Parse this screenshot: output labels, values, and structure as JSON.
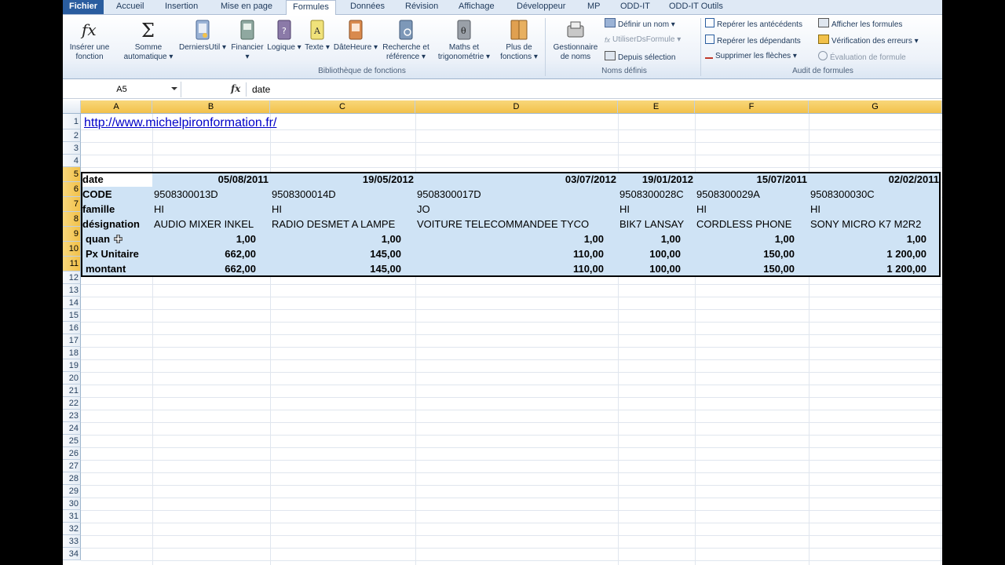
{
  "tabs": {
    "file": "Fichier",
    "items": [
      "Accueil",
      "Insertion",
      "Mise en page",
      "Formules",
      "Données",
      "Révision",
      "Affichage",
      "Développeur",
      "MP",
      "ODD-IT",
      "ODD-IT Outils"
    ]
  },
  "ribbon": {
    "insert_fn": [
      "Insérer une",
      "fonction"
    ],
    "autosum": [
      "Somme",
      "automatique ▾"
    ],
    "lib_buttons": [
      {
        "label": "DerniersUtil ▾",
        "icon": "recently-used-icon"
      },
      {
        "label": "Financier ▾",
        "icon": "financial-icon"
      },
      {
        "label": "Logique ▾",
        "icon": "logical-icon"
      },
      {
        "label": "Texte ▾",
        "icon": "text-icon"
      },
      {
        "label": "DâteHeure ▾",
        "icon": "date-time-icon"
      },
      {
        "label": "Recherche et",
        "label2": "référence ▾",
        "icon": "lookup-icon"
      },
      {
        "label": "Maths et",
        "label2": "trigonométrie ▾",
        "icon": "math-icon"
      },
      {
        "label": "Plus de",
        "label2": "fonctions ▾",
        "icon": "more-functions-icon"
      }
    ],
    "lib_group": "Bibliothèque de fonctions",
    "name_manager": [
      "Gestionnaire",
      "de noms"
    ],
    "names": {
      "define": "Définir un nom ▾",
      "use": "UtiliserDsFormule ▾",
      "from_sel": "Depuis sélection",
      "group": "Noms définis"
    },
    "audit": {
      "precedents": "Repérer les antécédents",
      "dependents": "Repérer les dépendants",
      "remove_arrows": "Supprimer les flèches ▾",
      "show_formulas": "Afficher les formules",
      "error_check": "Vérification des erreurs ▾",
      "evaluate": "Évaluation de formule",
      "group": "Audit de formules"
    }
  },
  "formula_bar": {
    "name_box": "A5",
    "fx": "fx",
    "content": "date"
  },
  "columns": [
    "A",
    "B",
    "C",
    "D",
    "E",
    "F",
    "G"
  ],
  "rows": [
    "1",
    "2",
    "3",
    "4",
    "5",
    "6",
    "7",
    "8",
    "9",
    "10",
    "11",
    "12",
    "13",
    "14",
    "15",
    "16",
    "17",
    "18",
    "19",
    "20",
    "21",
    "22",
    "23",
    "24",
    "25",
    "26",
    "27",
    "28",
    "29",
    "30",
    "31",
    "32",
    "33",
    "34"
  ],
  "link": "http://www.michelpironformation.fr/",
  "table": {
    "labels": [
      "date",
      "CODE",
      "famille",
      "désignation",
      "quan",
      "Px Unitaire",
      "montant"
    ],
    "dates": [
      "05/08/2011",
      "19/05/2012",
      "03/07/2012",
      "19/01/2012",
      "15/07/2011",
      "02/02/2011"
    ],
    "codes": [
      "9508300013D",
      "9508300014D",
      "9508300017D",
      "9508300028C",
      "9508300029A",
      "9508300030C"
    ],
    "familles": [
      "HI",
      "HI",
      "JO",
      "HI",
      "HI",
      "HI"
    ],
    "designations": [
      "AUDIO MIXER INKEL",
      "RADIO DESMET A LAMPE",
      "VOITURE TELECOMMANDEE TYCO",
      "BIK7 LANSAY",
      "CORDLESS PHONE",
      "SONY MICRO K7 M2R2"
    ],
    "quantites": [
      "1,00",
      "1,00",
      "1,00",
      "1,00",
      "1,00",
      "1,00"
    ],
    "prix": [
      "662,00",
      "145,00",
      "110,00",
      "100,00",
      "150,00",
      "1 200,00"
    ],
    "montants": [
      "662,00",
      "145,00",
      "110,00",
      "100,00",
      "150,00",
      "1 200,00"
    ]
  }
}
